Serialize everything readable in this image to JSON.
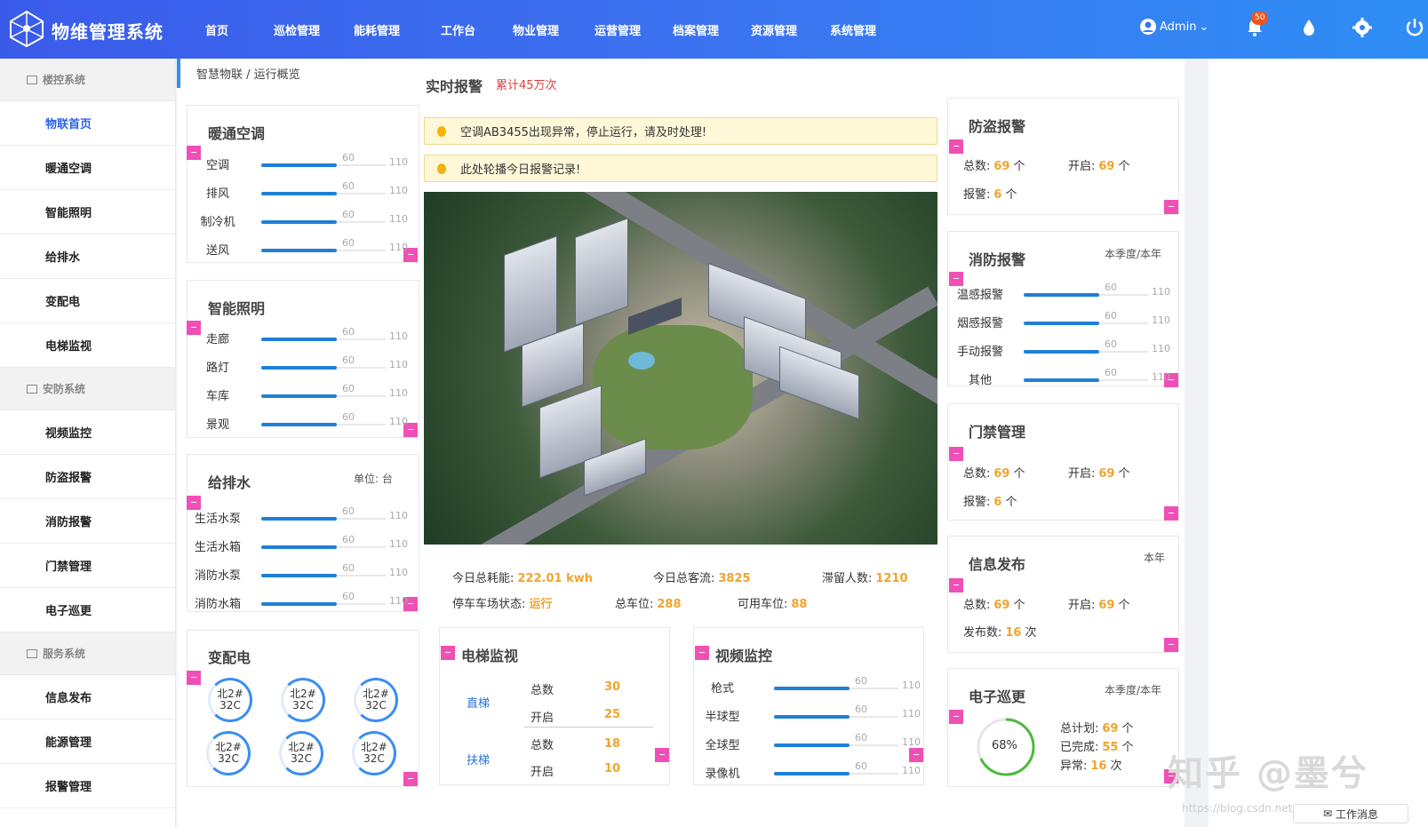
{
  "app": {
    "title": "物维管理系统"
  },
  "nav": [
    {
      "label": "首页"
    },
    {
      "label": "巡检管理"
    },
    {
      "label": "能耗管理"
    },
    {
      "label": "工作台"
    },
    {
      "label": "物业管理"
    },
    {
      "label": "运营管理"
    },
    {
      "label": "档案管理"
    },
    {
      "label": "资源管理"
    },
    {
      "label": "系统管理"
    }
  ],
  "user": {
    "name": "Admin",
    "notifications": "50"
  },
  "sidebar": {
    "groups": [
      {
        "label": "楼控系统",
        "items": [
          "物联首页",
          "暖通空调",
          "智能照明",
          "给排水",
          "变配电",
          "电梯监视"
        ]
      },
      {
        "label": "安防系统",
        "items": [
          "视频监控",
          "防盗报警",
          "消防报警",
          "门禁管理",
          "电子巡更"
        ]
      },
      {
        "label": "服务系统",
        "items": [
          "信息发布",
          "能源管理",
          "报警管理"
        ]
      }
    ]
  },
  "breadcrumb": "智慧物联 / 运行概览",
  "hvac": {
    "title": "暖通空调",
    "rows": [
      {
        "label": "空调",
        "v1": "60",
        "v2": "110"
      },
      {
        "label": "排风",
        "v1": "60",
        "v2": "110"
      },
      {
        "label": "制冷机",
        "v1": "60",
        "v2": "110"
      },
      {
        "label": "送风",
        "v1": "60",
        "v2": "110"
      }
    ]
  },
  "lighting": {
    "title": "智能照明",
    "rows": [
      {
        "label": "走廊",
        "v1": "60",
        "v2": "110"
      },
      {
        "label": "路灯",
        "v1": "60",
        "v2": "110"
      },
      {
        "label": "车库",
        "v1": "60",
        "v2": "110"
      },
      {
        "label": "景观",
        "v1": "60",
        "v2": "110"
      }
    ]
  },
  "water": {
    "title": "给排水",
    "unit": "单位:  台",
    "rows": [
      {
        "label": "生活水泵",
        "v1": "60",
        "v2": "110"
      },
      {
        "label": "生活水箱",
        "v1": "60",
        "v2": "110"
      },
      {
        "label": "消防水泵",
        "v1": "60",
        "v2": "110"
      },
      {
        "label": "消防水箱",
        "v1": "60",
        "v2": "110"
      }
    ]
  },
  "power": {
    "title": "变配电",
    "rings": [
      {
        "a": "北2#",
        "b": "32C"
      },
      {
        "a": "北2#",
        "b": "32C"
      },
      {
        "a": "北2#",
        "b": "32C"
      },
      {
        "a": "北2#",
        "b": "32C"
      },
      {
        "a": "北2#",
        "b": "32C"
      },
      {
        "a": "北2#",
        "b": "32C"
      }
    ]
  },
  "alarm": {
    "title": "实时报警",
    "total": "累计45万次",
    "alerts": [
      "空调AB3455出现异常，停止运行，请及时处理!",
      "此处轮播今日报警记录!"
    ]
  },
  "summary": {
    "energy_label": "今日总耗能:",
    "energy": "222.01 kwh",
    "flow_label": "今日总客流:",
    "flow": "3825",
    "stay_label": "滞留人数:",
    "stay": "1210",
    "park_label": "停车车场状态:",
    "park": "运行",
    "spots_label": "总车位:",
    "spots": "288",
    "free_label": "可用车位:",
    "free": "88"
  },
  "elevator": {
    "title": "电梯监视",
    "straight": {
      "name": "直梯",
      "total_label": "总数",
      "total": "30",
      "open_label": "开启",
      "open": "25"
    },
    "escalator": {
      "name": "扶梯",
      "total_label": "总数",
      "total": "18",
      "open_label": "开启",
      "open": "10"
    }
  },
  "video": {
    "title": "视频监控",
    "rows": [
      {
        "label": "枪式",
        "v1": "60",
        "v2": "110"
      },
      {
        "label": "半球型",
        "v1": "60",
        "v2": "110"
      },
      {
        "label": "全球型",
        "v1": "60",
        "v2": "110"
      },
      {
        "label": "录像机",
        "v1": "60",
        "v2": "110"
      }
    ]
  },
  "theft": {
    "title": "防盗报警",
    "total_label": "总数:",
    "total": "69",
    "total_unit": "个",
    "open_label": "开启:",
    "open": "69",
    "open_unit": "个",
    "alarm_label": "报警:",
    "alarm": "6",
    "alarm_unit": "个"
  },
  "fire": {
    "title": "消防报警",
    "period": "本季度/本年",
    "rows": [
      {
        "label": "温感报警",
        "v1": "60",
        "v2": "110"
      },
      {
        "label": "烟感报警",
        "v1": "60",
        "v2": "110"
      },
      {
        "label": "手动报警",
        "v1": "60",
        "v2": "110"
      },
      {
        "label": "其他",
        "v1": "60",
        "v2": "110"
      }
    ]
  },
  "access": {
    "title": "门禁管理",
    "total_label": "总数:",
    "total": "69",
    "total_unit": "个",
    "open_label": "开启:",
    "open": "69",
    "open_unit": "个",
    "alarm_label": "报警:",
    "alarm": "6",
    "alarm_unit": "个"
  },
  "info": {
    "title": "信息发布",
    "period": "本年",
    "total_label": "总数:",
    "total": "69",
    "total_unit": "个",
    "open_label": "开启:",
    "open": "69",
    "open_unit": "个",
    "pub_label": "发布数:",
    "pub": "16",
    "pub_unit": "次"
  },
  "patrol": {
    "title": "电子巡更",
    "period": "本季度/本年",
    "percent": "68%",
    "plan_label": "总计划:",
    "plan": "69",
    "plan_unit": "个",
    "done_label": "已完成:",
    "done": "55",
    "done_unit": "个",
    "err_label": "异常:",
    "err": "16",
    "err_unit": "次"
  },
  "footer": {
    "work_msg": "工作消息"
  },
  "watermark": {
    "text": "知乎 @墨兮",
    "url": "https://blog.csdn.net/..."
  }
}
